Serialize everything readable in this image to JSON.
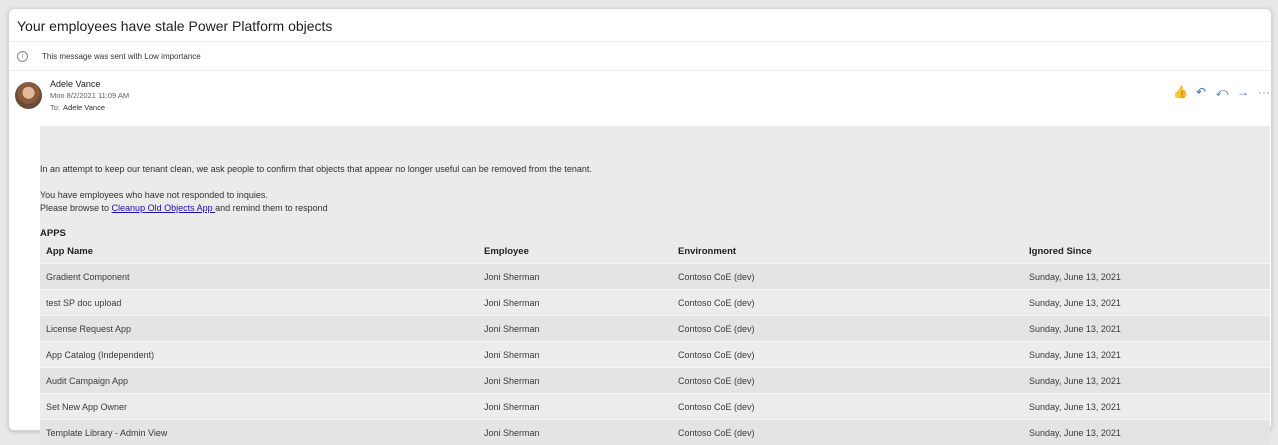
{
  "email": {
    "subject": "Your employees have stale Power Platform objects",
    "importance_note": "This message was sent with Low importance",
    "sender": "Adele Vance",
    "date": "Mon 8/2/2021 11:09 AM",
    "to_label": "To:",
    "to": "Adele Vance"
  },
  "actions": [
    {
      "name": "like-icon",
      "glyph": "👍"
    },
    {
      "name": "reply-icon",
      "glyph": "↶"
    },
    {
      "name": "reply-all-icon",
      "glyph": "⤺"
    },
    {
      "name": "forward-icon",
      "glyph": "→"
    },
    {
      "name": "more-icon",
      "glyph": "···"
    }
  ],
  "body": {
    "line1": "In an attempt to keep our tenant clean, we ask people to confirm that objects that appear no longer useful can be removed from the tenant.",
    "line2": "You have employees who have not responded to inquies.",
    "line3_prefix": "Please browse to ",
    "link_text": "Cleanup Old Objects App ",
    "line3_suffix": "and remind them to respond",
    "section_title": "APPS"
  },
  "table": {
    "headers": [
      "App Name",
      "Employee",
      "Environment",
      "Ignored Since"
    ],
    "rows": [
      [
        "Gradient Component",
        "Joni Sherman",
        "Contoso CoE (dev)",
        "Sunday, June 13, 2021"
      ],
      [
        "test SP doc upload",
        "Joni Sherman",
        "Contoso CoE (dev)",
        "Sunday, June 13, 2021"
      ],
      [
        "License Request App",
        "Joni Sherman",
        "Contoso CoE (dev)",
        "Sunday, June 13, 2021"
      ],
      [
        "App Catalog (Independent)",
        "Joni Sherman",
        "Contoso CoE (dev)",
        "Sunday, June 13, 2021"
      ],
      [
        "Audit Campaign App",
        "Joni Sherman",
        "Contoso CoE (dev)",
        "Sunday, June 13, 2021"
      ],
      [
        "Set New App Owner",
        "Joni Sherman",
        "Contoso CoE (dev)",
        "Sunday, June 13, 2021"
      ],
      [
        "Template Library - Admin View",
        "Joni Sherman",
        "Contoso CoE (dev)",
        "Sunday, June 13, 2021"
      ]
    ]
  }
}
